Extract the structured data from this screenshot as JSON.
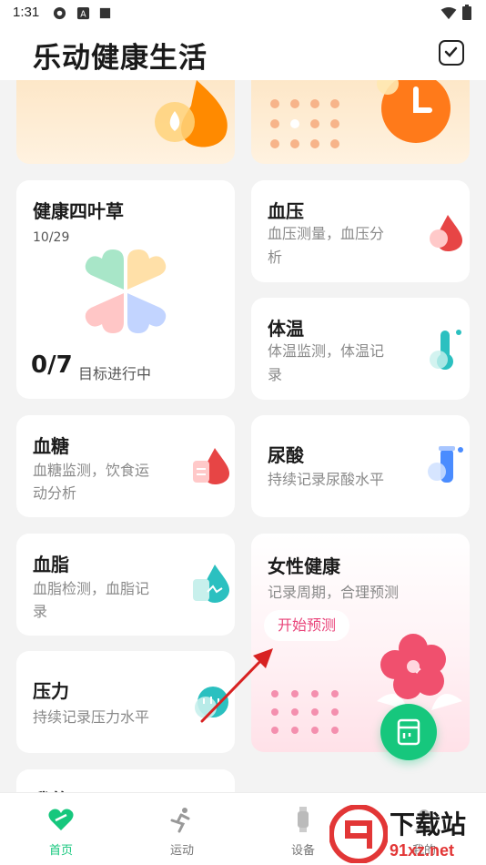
{
  "status_bar": {
    "time": "1:31"
  },
  "header": {
    "title": "乐动健康生活"
  },
  "cards": {
    "clover": {
      "title": "健康四叶草",
      "date": "10/29",
      "score": "0/7",
      "score_label": "目标进行中"
    },
    "blood_pressure": {
      "title": "血压",
      "sub_line1": "血压测量，血压分",
      "sub_line2": "析"
    },
    "temperature": {
      "title": "体温",
      "sub_line1": "体温监测，体温记",
      "sub_line2": "录"
    },
    "blood_sugar": {
      "title": "血糖",
      "sub_line1": "血糖监测，饮食运",
      "sub_line2": "动分析"
    },
    "uric_acid": {
      "title": "尿酸",
      "sub_line1": "持续记录尿酸水平"
    },
    "blood_lipid": {
      "title": "血脂",
      "sub_line1": "血脂检测，血脂记",
      "sub_line2": "录"
    },
    "female_health": {
      "title": "女性健康",
      "sub_line1": "记录周期，合理预测",
      "button": "开始预测"
    },
    "stress": {
      "title": "压力",
      "sub_line1": "持续记录压力水平"
    },
    "partial_card": {
      "title": "我的"
    }
  },
  "bottom_nav": [
    {
      "label": "首页",
      "active": true
    },
    {
      "label": "运动",
      "active": false
    },
    {
      "label": "设备",
      "active": false
    },
    {
      "label": "我的",
      "active": false
    }
  ],
  "watermark": {
    "text": "下载站",
    "url_text": "91xz.net"
  },
  "colors": {
    "accent": "#16c77d",
    "pink": "#e9447a",
    "red": "#e74545"
  }
}
